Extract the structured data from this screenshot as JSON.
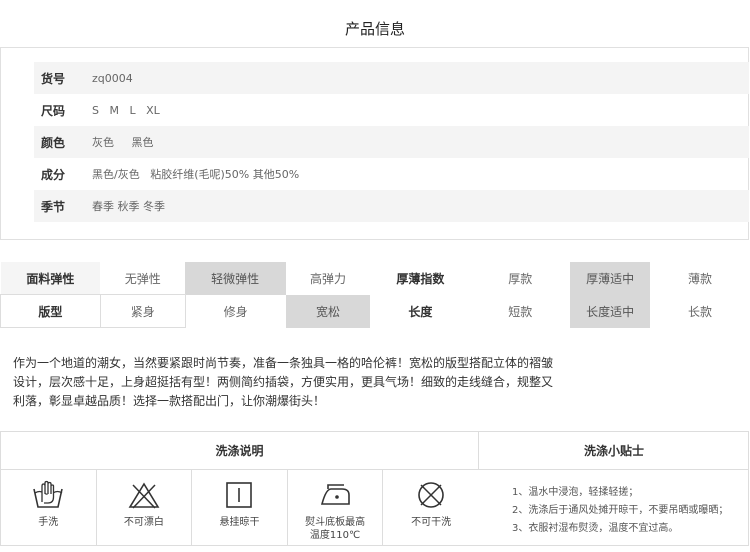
{
  "title": "产品信息",
  "info": [
    {
      "label": "货号",
      "value": "zq0004"
    },
    {
      "label": "尺码",
      "value": "S   M   L   XL"
    },
    {
      "label": "颜色",
      "value": "灰色     黑色"
    },
    {
      "label": "成分",
      "value": "黑色/灰色   粘胶纤维(毛呢)50% 其他50%"
    },
    {
      "label": "季节",
      "value": "春季 秋季 冬季"
    }
  ],
  "attributes": {
    "row1": {
      "elastic_label": "面料弹性",
      "elastic_options": [
        "无弹性",
        "轻微弹性",
        "高弹力"
      ],
      "elastic_selected": "轻微弹性",
      "thickness_label": "厚薄指数",
      "thickness_options": [
        "厚款",
        "厚薄适中",
        "薄款"
      ],
      "thickness_selected": "厚薄适中"
    },
    "row2": {
      "fit_label": "版型",
      "fit_options": [
        "紧身",
        "修身",
        "宽松"
      ],
      "fit_selected": "宽松",
      "length_label": "长度",
      "length_options": [
        "短款",
        "长度适中",
        "长款"
      ],
      "length_selected": "长度适中"
    }
  },
  "description": [
    "作为一个地道的潮女，当然要紧跟时尚节奏，准备一条独具一格的哈伦裤！宽松的版型搭配立体的褶皱",
    "设计，层次感十足，上身超挺括有型！两侧简约插袋，方便实用，更具气场！细致的走线缝合，规整又",
    "利落，彰显卓越品质！选择一款搭配出门，让你潮爆街头！"
  ],
  "wash": {
    "title": "洗涤说明",
    "tips_title": "洗涤小贴士",
    "icons": [
      {
        "icon": "hand-wash-icon",
        "caption": "手洗"
      },
      {
        "icon": "no-bleach-icon",
        "caption": "不可漂白"
      },
      {
        "icon": "hang-dry-icon",
        "caption": "悬挂晾干"
      },
      {
        "icon": "iron-icon",
        "caption": "熨斗底板最高",
        "caption2": "温度110℃"
      },
      {
        "icon": "no-dry-clean-icon",
        "caption": "不可干洗"
      }
    ],
    "tips": [
      "1、温水中浸泡，轻揉轻搓；",
      "2、洗涤后于通风处摊开晾干，不要吊晒或曝晒；",
      "3、衣服衬湿布熨烫，温度不宜过高。"
    ]
  }
}
